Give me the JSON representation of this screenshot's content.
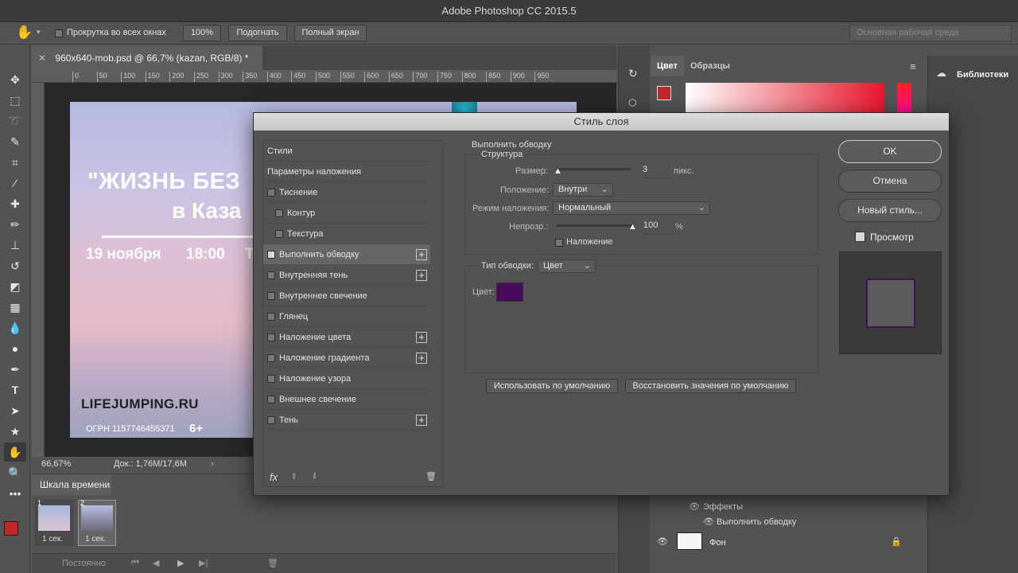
{
  "app": {
    "title": "Adobe Photoshop CC 2015.5"
  },
  "options_bar": {
    "scroll_all_windows": "Прокрутка во всех окнах",
    "zoom_100": "100%",
    "fit": "Подогнать",
    "full_screen": "Полный экран",
    "workspace": "Основная рабочая среда"
  },
  "document": {
    "tab_title": "960x640-mob.psd @ 66,7% (kazan, RGB/8) *",
    "ruler_ticks": [
      "0",
      "50",
      "100",
      "150",
      "200",
      "250",
      "300",
      "350",
      "400",
      "450",
      "500",
      "550",
      "600",
      "650",
      "700",
      "750",
      "800",
      "850",
      "900",
      "950"
    ],
    "zoom": "66,67%",
    "doc_size": "Док.: 1,76M/17,6M",
    "artwork": {
      "headline": "\"ЖИЗНЬ БЕЗ",
      "subline": "в Каза",
      "date": "19 ноября",
      "time": "18:00",
      "extra": "Т",
      "site": "LIFEJUMPING.RU",
      "ogrn": "ОГРН 1157746455371",
      "age": "6+"
    }
  },
  "timeline": {
    "title": "Шкала времени",
    "frames": [
      {
        "num": "1",
        "delay": "1 сек."
      },
      {
        "num": "2",
        "delay": "1 сек."
      }
    ],
    "loop": "Постоянно"
  },
  "color_panel": {
    "tab_color": "Цвет",
    "tab_swatches": "Образцы",
    "fg_color": "#c0282d"
  },
  "libraries": {
    "label": "Библиотеки"
  },
  "layers_panel": {
    "effects": "Эффекты",
    "stroke": "Выполнить обводку",
    "background": "Фон"
  },
  "dialog": {
    "title": "Стиль слоя",
    "styles": [
      {
        "label": "Стили",
        "has_check": false,
        "has_plus": false,
        "checked": false,
        "indent": 0
      },
      {
        "label": "Параметры наложения",
        "has_check": false,
        "has_plus": false,
        "checked": false,
        "indent": 0
      },
      {
        "label": "Тиснение",
        "has_check": true,
        "has_plus": false,
        "checked": false,
        "indent": 0
      },
      {
        "label": "Контур",
        "has_check": true,
        "has_plus": false,
        "checked": false,
        "indent": 1
      },
      {
        "label": "Текстура",
        "has_check": true,
        "has_plus": false,
        "checked": false,
        "indent": 1
      },
      {
        "label": "Выполнить обводку",
        "has_check": true,
        "has_plus": true,
        "checked": true,
        "indent": 0
      },
      {
        "label": "Внутренняя тень",
        "has_check": true,
        "has_plus": true,
        "checked": false,
        "indent": 0
      },
      {
        "label": "Внутреннее свечение",
        "has_check": true,
        "has_plus": false,
        "checked": false,
        "indent": 0
      },
      {
        "label": "Глянец",
        "has_check": true,
        "has_plus": false,
        "checked": false,
        "indent": 0
      },
      {
        "label": "Наложение цвета",
        "has_check": true,
        "has_plus": true,
        "checked": false,
        "indent": 0
      },
      {
        "label": "Наложение градиента",
        "has_check": true,
        "has_plus": true,
        "checked": false,
        "indent": 0
      },
      {
        "label": "Наложение узора",
        "has_check": true,
        "has_plus": false,
        "checked": false,
        "indent": 0
      },
      {
        "label": "Внешнее свечение",
        "has_check": true,
        "has_plus": false,
        "checked": false,
        "indent": 0
      },
      {
        "label": "Тень",
        "has_check": true,
        "has_plus": true,
        "checked": false,
        "indent": 0
      }
    ],
    "section_title": "Выполнить обводку",
    "structure_title": "Структура",
    "size_label": "Размер:",
    "size_value": "3",
    "size_unit": "пикс.",
    "position_label": "Положение:",
    "position_value": "Внутри",
    "blend_label": "Режим наложения:",
    "blend_value": "Нормальный",
    "opacity_label": "Непрозр.:",
    "opacity_value": "100",
    "opacity_unit": "%",
    "overprint_label": "Наложение",
    "fill_type_label": "Тип обводки:",
    "fill_type_value": "Цвет",
    "color_label": "Цвет:",
    "stroke_color": "#4a0b5e",
    "make_default": "Использовать по умолчанию",
    "reset_default": "Восстановить значения по умолчанию",
    "ok": "OK",
    "cancel": "Отмена",
    "new_style": "Новый стиль...",
    "preview": "Просмотр"
  }
}
